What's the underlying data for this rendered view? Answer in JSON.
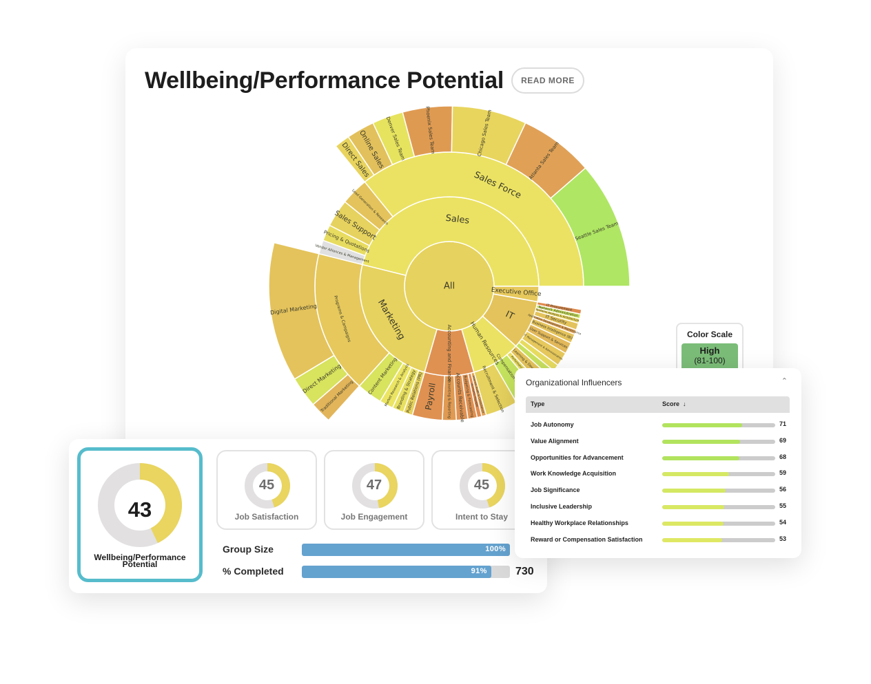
{
  "header": {
    "title": "Wellbeing/Performance Potential",
    "read_more_label": "READ MORE"
  },
  "color_scale": {
    "title": "Color Scale",
    "high_label": "High",
    "high_range": "(81-100)",
    "high_color": "#7bbd78"
  },
  "chart_data": {
    "type": "sunburst",
    "title": "Wellbeing/Performance Potential",
    "root": "All",
    "nodes": [
      {
        "id": "all",
        "label": "All",
        "parent": "",
        "level": 0,
        "start": 0,
        "end": 360,
        "color": "#e6d25e",
        "font": 13
      },
      {
        "id": "sales",
        "label": "Sales",
        "parent": "all",
        "level": 1,
        "start": -76,
        "end": 90,
        "color": "#ebe263",
        "font": 13
      },
      {
        "id": "exec",
        "label": "Executive Office",
        "parent": "all",
        "level": 1,
        "start": 90,
        "end": 100,
        "color": "#e6c85c",
        "font": 9
      },
      {
        "id": "it",
        "label": "IT",
        "parent": "all",
        "level": 1,
        "start": 100,
        "end": 132,
        "color": "#e4c35c",
        "font": 13
      },
      {
        "id": "hr",
        "label": "Human Resources",
        "parent": "all",
        "level": 1,
        "start": 132,
        "end": 164,
        "color": "#ebe263",
        "font": 8
      },
      {
        "id": "acct",
        "label": "Accounting and Finance",
        "parent": "all",
        "level": 1,
        "start": 164,
        "end": 196,
        "color": "#df9152",
        "font": 7
      },
      {
        "id": "mkt",
        "label": "Marketing",
        "parent": "all",
        "level": 1,
        "start": 196,
        "end": 284,
        "color": "#e6d25e",
        "font": 13
      },
      {
        "id": "salesforce",
        "label": "Sales Force",
        "parent": "sales",
        "level": 2,
        "start": -39,
        "end": 90,
        "color": "#ebe263",
        "font": 13
      },
      {
        "id": "leadgen",
        "label": "Lead Generation & Research",
        "parent": "sales",
        "level": 2,
        "start": -51,
        "end": -39,
        "color": "#e4c35c",
        "font": 5
      },
      {
        "id": "salessup",
        "label": "Sales Support",
        "parent": "sales",
        "level": 2,
        "start": -63,
        "end": -51,
        "color": "#e6d25e",
        "font": 10
      },
      {
        "id": "pricing",
        "label": "Pricing & Quotations",
        "parent": "sales",
        "level": 2,
        "start": -70,
        "end": -63,
        "color": "#e8dc60",
        "font": 7
      },
      {
        "id": "vendor",
        "label": "Vendor Alliances & Management",
        "parent": "sales",
        "level": 2,
        "start": -76,
        "end": -70,
        "color": "#e0e0e0",
        "font": 5
      },
      {
        "id": "dirsales",
        "label": "Direct Sales",
        "parent": "salesforce",
        "level": 3,
        "start": -39,
        "end": -34,
        "color": "#e8d45e",
        "font": 10
      },
      {
        "id": "onsales",
        "label": "Online Sales",
        "parent": "salesforce",
        "level": 3,
        "start": -34,
        "end": -25,
        "color": "#e2c05c",
        "font": 10
      },
      {
        "id": "denver",
        "label": "Denver Sales Team",
        "parent": "salesforce",
        "level": 3,
        "start": -25,
        "end": -15,
        "color": "#e6e35e",
        "font": 7
      },
      {
        "id": "phoenix",
        "label": "Phoenix Sales Team",
        "parent": "salesforce",
        "level": 3,
        "start": -15,
        "end": 1,
        "color": "#df9a52",
        "font": 7
      },
      {
        "id": "chicago",
        "label": "Chicago Sales Team",
        "parent": "salesforce",
        "level": 3,
        "start": 1,
        "end": 25,
        "color": "#e8d55e",
        "font": 7
      },
      {
        "id": "atlanta",
        "label": "Atlanta Sales Team",
        "parent": "salesforce",
        "level": 3,
        "start": 25,
        "end": 49,
        "color": "#e0a157",
        "font": 7
      },
      {
        "id": "seattle",
        "label": "Seattle Sales Team",
        "parent": "salesforce",
        "level": 3,
        "start": 49,
        "end": 90,
        "color": "#afe663",
        "font": 7
      },
      {
        "id": "itproc",
        "label": "IT Procurement",
        "parent": "it",
        "level": 2,
        "start": 100,
        "end": 102,
        "color": "#df8a4e",
        "font": 5
      },
      {
        "id": "netadmin",
        "label": "Network Administration",
        "parent": "it",
        "level": 2,
        "start": 102,
        "end": 104,
        "color": "#c8e15e",
        "font": 5
      },
      {
        "id": "sysan",
        "label": "Systems Analysis & Architecture",
        "parent": "it",
        "level": 2,
        "start": 104,
        "end": 106,
        "color": "#e6d25e",
        "font": 4
      },
      {
        "id": "itsec",
        "label": "IT Security",
        "parent": "it",
        "level": 2,
        "start": 106,
        "end": 109,
        "color": "#e4c35c",
        "font": 6
      },
      {
        "id": "appdev",
        "label": "Application Development & Maintenance",
        "parent": "it",
        "level": 2,
        "start": 109,
        "end": 111,
        "color": "#e0a157",
        "font": 4
      },
      {
        "id": "bi",
        "label": "Business Intelligence (BI)",
        "parent": "it",
        "level": 2,
        "start": 111,
        "end": 115,
        "color": "#e4c35c",
        "font": 5
      },
      {
        "id": "usersup",
        "label": "User Support & Services",
        "parent": "it",
        "level": 2,
        "start": 115,
        "end": 120,
        "color": "#e2b85a",
        "font": 5
      },
      {
        "id": "itmgmt",
        "label": "IT Management & Administration",
        "parent": "it",
        "level": 2,
        "start": 120,
        "end": 126,
        "color": "#e6c85c",
        "font": 4
      },
      {
        "id": "itother1",
        "label": "",
        "parent": "it",
        "level": 2,
        "start": 126,
        "end": 129,
        "color": "#e8dc60",
        "font": 4
      },
      {
        "id": "itother2",
        "label": "",
        "parent": "it",
        "level": 2,
        "start": 129,
        "end": 132,
        "color": "#c8e15e",
        "font": 4
      },
      {
        "id": "hrlearn",
        "label": "Learning & Development",
        "parent": "hr",
        "level": 2,
        "start": 132,
        "end": 137,
        "color": "#e4c35c",
        "font": 5
      },
      {
        "id": "hrperf",
        "label": "Performance Management",
        "parent": "hr",
        "level": 2,
        "start": 137,
        "end": 140,
        "color": "#e8dc60",
        "font": 4
      },
      {
        "id": "hrcomp",
        "label": "Compensation and Benefits",
        "parent": "hr",
        "level": 2,
        "start": 140,
        "end": 150,
        "color": "#c5e35e",
        "font": 6
      },
      {
        "id": "hrrec",
        "label": "Recruitment & Selection",
        "parent": "hr",
        "level": 2,
        "start": 150,
        "end": 164,
        "color": "#e6d25e",
        "font": 6
      },
      {
        "id": "ifraud",
        "label": "Internal Audit & Compliance",
        "parent": "acct",
        "level": 2,
        "start": 164,
        "end": 166,
        "color": "#e0a157",
        "font": 4
      },
      {
        "id": "apay",
        "label": "Accounts Payable",
        "parent": "acct",
        "level": 2,
        "start": 166,
        "end": 168,
        "color": "#df8a4e",
        "font": 4
      },
      {
        "id": "budget",
        "label": "Budgeting & Forecasting",
        "parent": "acct",
        "level": 2,
        "start": 168,
        "end": 172,
        "color": "#df9152",
        "font": 5
      },
      {
        "id": "arec",
        "label": "Accounts Receivable",
        "parent": "acct",
        "level": 2,
        "start": 172,
        "end": 177,
        "color": "#df9152",
        "font": 7
      },
      {
        "id": "acctrep",
        "label": "Accounting & Reporting",
        "parent": "acct",
        "level": 2,
        "start": 177,
        "end": 183,
        "color": "#e09a52",
        "font": 5
      },
      {
        "id": "payroll",
        "label": "Payroll",
        "parent": "acct",
        "level": 2,
        "start": 183,
        "end": 196,
        "color": "#df9152",
        "font": 12
      },
      {
        "id": "pr",
        "label": "Public Relations (PR)",
        "parent": "mkt",
        "level": 2,
        "start": 196,
        "end": 200,
        "color": "#e6d25e",
        "font": 6
      },
      {
        "id": "brand",
        "label": "Branding & Strategy",
        "parent": "mkt",
        "level": 2,
        "start": 200,
        "end": 205,
        "color": "#e8e060",
        "font": 6
      },
      {
        "id": "mres",
        "label": "Market Research & Analysis",
        "parent": "mkt",
        "level": 2,
        "start": 205,
        "end": 211,
        "color": "#ebe563",
        "font": 5
      },
      {
        "id": "content",
        "label": "Content Marketing",
        "parent": "mkt",
        "level": 2,
        "start": 211,
        "end": 222,
        "color": "#d8e35e",
        "font": 7
      },
      {
        "id": "progs",
        "label": "Programs & Campaigns",
        "parent": "mkt",
        "level": 2,
        "start": 222,
        "end": 284,
        "color": "#e6c85c",
        "font": 6
      },
      {
        "id": "tradmkt",
        "label": "Traditional Marketing",
        "parent": "progs",
        "level": 3,
        "start": 222,
        "end": 229,
        "color": "#e2b55a",
        "font": 6
      },
      {
        "id": "dirmkt",
        "label": "Direct Marketing",
        "parent": "progs",
        "level": 3,
        "start": 229,
        "end": 239,
        "color": "#d8e35e",
        "font": 8
      },
      {
        "id": "digmkt",
        "label": "Digital Marketing",
        "parent": "progs",
        "level": 3,
        "start": 239,
        "end": 284,
        "color": "#e4c35c",
        "font": 8
      }
    ]
  },
  "scores": {
    "main": {
      "value": 43,
      "label": "Wellbeing/Performance Potential",
      "fraction": 0.43
    },
    "subs": [
      {
        "value": 45,
        "label": "Job Satisfaction",
        "fraction": 0.45
      },
      {
        "value": 47,
        "label": "Job Engagement",
        "fraction": 0.47
      },
      {
        "value": 45,
        "label": "Intent to Stay",
        "fraction": 0.45
      }
    ],
    "ring_color": "#e9d55f",
    "track_color": "#e2e0e0"
  },
  "stats": {
    "group_size": {
      "label": "Group Size",
      "percent": 100,
      "percent_label": "100%"
    },
    "completed": {
      "label": "% Completed",
      "percent": 91,
      "percent_label": "91%",
      "count": "730"
    }
  },
  "influencers": {
    "title": "Organizational Influencers",
    "collapse_icon": "chevron-up-icon",
    "columns": {
      "type": "Type",
      "score": "Score",
      "sort_icon": "arrow-down-icon"
    },
    "rows": [
      {
        "type": "Job Autonomy",
        "score": 71,
        "color": "#b2e35e"
      },
      {
        "type": "Value Alignment",
        "score": 69,
        "color": "#b2e35e"
      },
      {
        "type": "Opportunities for Advancement",
        "score": 68,
        "color": "#b2e35e"
      },
      {
        "type": "Work Knowledge Acquisition",
        "score": 59,
        "color": "#d5e863"
      },
      {
        "type": "Job Significance",
        "score": 56,
        "color": "#d5e863"
      },
      {
        "type": "Inclusive Leadership",
        "score": 55,
        "color": "#d8e863"
      },
      {
        "type": "Healthy Workplace Relationships",
        "score": 54,
        "color": "#dce863"
      },
      {
        "type": "Reward or Compensation Satisfaction",
        "score": 53,
        "color": "#dfe863"
      }
    ]
  }
}
